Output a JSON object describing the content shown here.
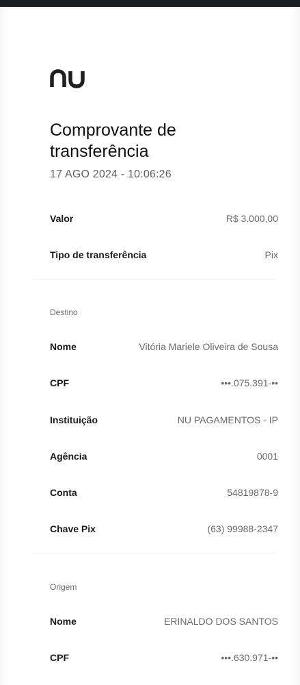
{
  "header": {
    "logo_text": "nu",
    "title": "Comprovante de transferência",
    "timestamp": "17 AGO 2024 - 10:06:26"
  },
  "summary": [
    {
      "label": "Valor",
      "value": "R$ 3.000,00"
    },
    {
      "label": "Tipo de transferência",
      "value": "Pix"
    }
  ],
  "destino": {
    "title": "Destino",
    "rows": [
      {
        "label": "Nome",
        "value": "Vitória Mariele Oliveira de Sousa"
      },
      {
        "label": "CPF",
        "value": "•••.075.391-••"
      },
      {
        "label": "Instituição",
        "value": "NU PAGAMENTOS - IP"
      },
      {
        "label": "Agência",
        "value": "0001"
      },
      {
        "label": "Conta",
        "value": "54819878-9"
      },
      {
        "label": "Chave Pix",
        "value": "(63) 99988-2347"
      }
    ]
  },
  "origem": {
    "title": "Origem",
    "rows": [
      {
        "label": "Nome",
        "value": "ERINALDO DOS SANTOS"
      },
      {
        "label": "CPF",
        "value": "•••.630.971-••"
      }
    ]
  },
  "colors": {
    "status_bar": "#1b1e21",
    "logo": "#1f1f1f",
    "text_primary": "#1a1a1a",
    "text_secondary": "#6a6a6a",
    "divider": "#ececec"
  }
}
